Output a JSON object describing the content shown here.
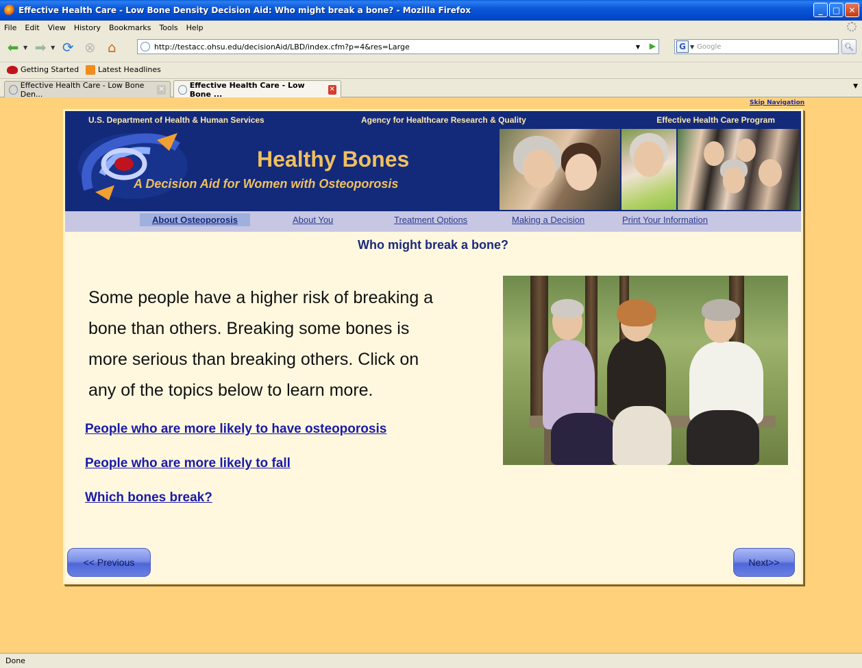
{
  "window": {
    "title": "Effective Health Care - Low Bone Density Decision Aid: Who might break a bone? - Mozilla Firefox"
  },
  "menu": [
    "File",
    "Edit",
    "View",
    "History",
    "Bookmarks",
    "Tools",
    "Help"
  ],
  "toolbar": {
    "url": "http://testacc.ohsu.edu/decisionAid/LBD/index.cfm?p=4&res=Large",
    "search_placeholder": "Google",
    "search_engine_letter": "G"
  },
  "bookmarks": [
    "Getting Started",
    "Latest Headlines"
  ],
  "tabs": [
    {
      "label": "Effective Health Care - Low Bone Den..."
    },
    {
      "label": "Effective Health Care - Low Bone ..."
    }
  ],
  "page": {
    "skip_nav": "Skip Navigation",
    "banner": {
      "dept": "U.S. Department of Health & Human Services",
      "agency": "Agency for Healthcare Research & Quality",
      "program": "Effective Health Care Program",
      "title": "Healthy Bones",
      "subtitle": "A Decision Aid for Women with Osteoporosis"
    },
    "nav": [
      "About Osteoporosis",
      "About You",
      "Treatment Options",
      "Making a Decision",
      "Print Your Information"
    ],
    "heading": "Who might break a bone?",
    "intro_lines": [
      "Some people have a higher risk of breaking a",
      "bone than others. Breaking some bones is",
      "more serious than breaking others. Click on",
      "any of the topics below to learn more."
    ],
    "links": [
      "People who are more likely to have osteoporosis",
      "People who are more likely to fall",
      "Which bones break?"
    ],
    "prev_label": "<< Previous",
    "next_label": "Next>>"
  },
  "status": "Done",
  "colors": {
    "page_bg": "#ffd17b",
    "banner_bg": "#132a7a",
    "banner_text": "#f0c060",
    "link": "#1a1aa6"
  }
}
